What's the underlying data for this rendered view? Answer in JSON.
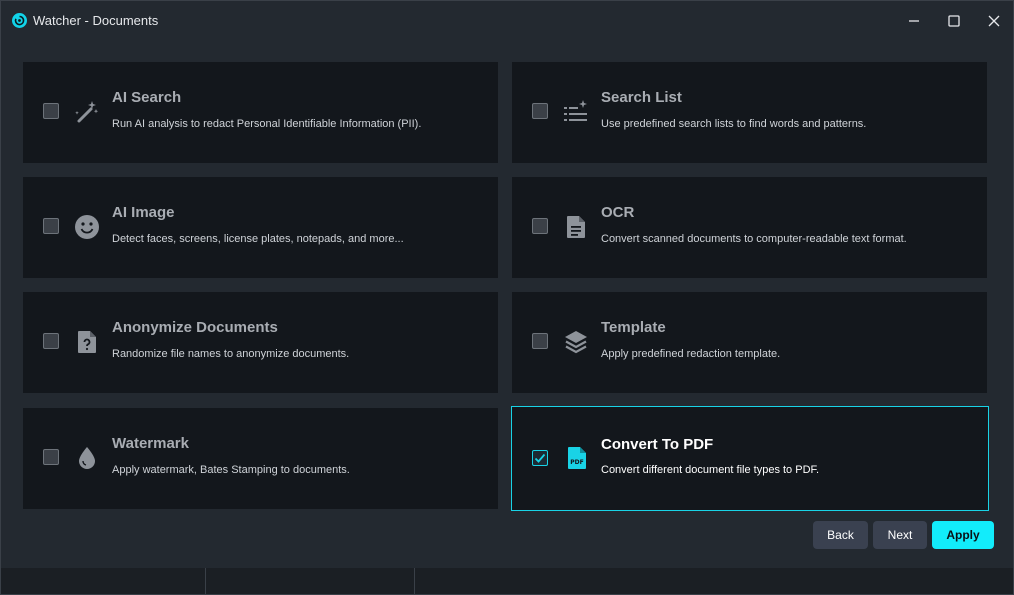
{
  "window": {
    "title": "Watcher - Documents",
    "accent_color": "#12d3e8"
  },
  "cards": [
    {
      "title": "AI Search",
      "description": "Run AI analysis to redact Personal Identifiable Information (PII).",
      "icon": "magic-wand-icon",
      "checked": false
    },
    {
      "title": "Search List",
      "description": "Use predefined search lists to find words and patterns.",
      "icon": "sparkle-list-icon",
      "checked": false
    },
    {
      "title": "AI Image",
      "description": "Detect faces, screens, license plates, notepads, and more...",
      "icon": "smiley-face-icon",
      "checked": false
    },
    {
      "title": "OCR",
      "description": "Convert scanned documents to computer-readable text format.",
      "icon": "document-text-icon",
      "checked": false
    },
    {
      "title": "Anonymize Documents",
      "description": "Randomize file names to anonymize documents.",
      "icon": "file-question-icon",
      "checked": false
    },
    {
      "title": "Template",
      "description": "Apply predefined redaction template.",
      "icon": "layers-icon",
      "checked": false
    },
    {
      "title": "Watermark",
      "description": "Apply watermark, Bates Stamping to documents.",
      "icon": "water-drop-icon",
      "checked": false
    },
    {
      "title": "Convert To PDF",
      "description": "Convert different document file types to PDF.",
      "icon": "pdf-file-icon",
      "checked": true
    }
  ],
  "buttons": {
    "back": "Back",
    "next": "Next",
    "apply": "Apply"
  }
}
